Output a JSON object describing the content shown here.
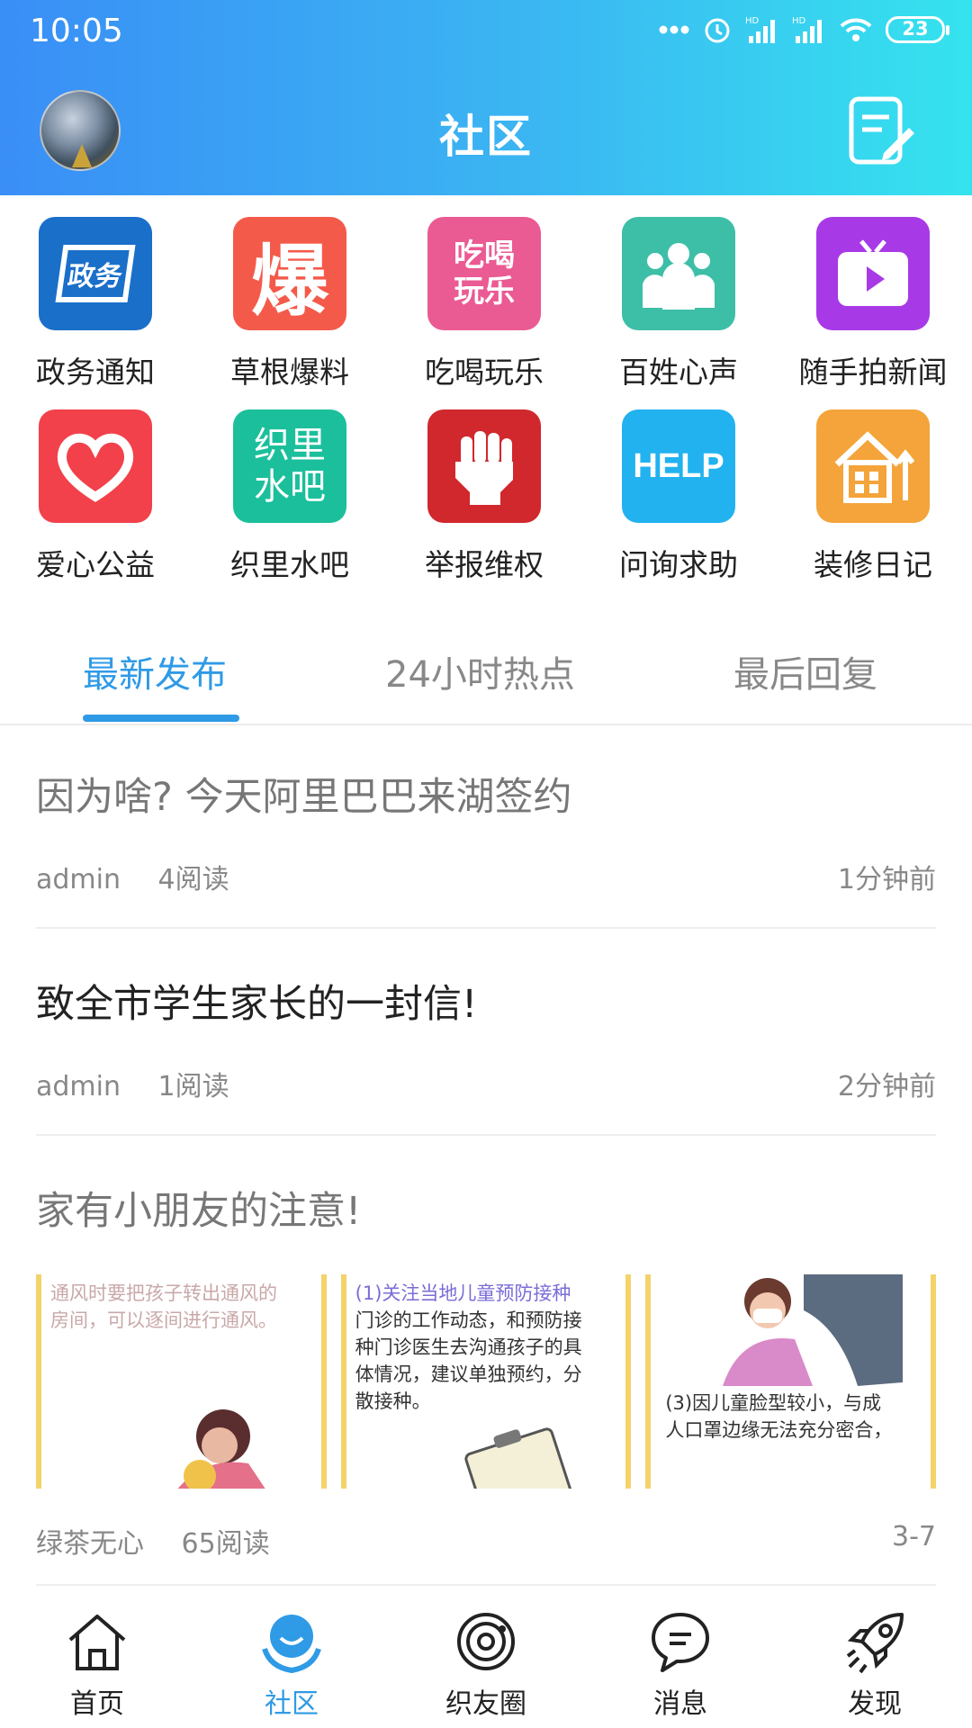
{
  "status_bar": {
    "time": "10:05",
    "battery": "23",
    "icons": [
      "dots-icon",
      "alarm-icon",
      "signal-hd-icon",
      "signal-hd-icon",
      "wifi-icon",
      "battery-icon"
    ]
  },
  "header": {
    "title": "社区",
    "avatar": "avatar",
    "compose_icon": "compose-icon"
  },
  "grid": [
    {
      "label": "政务通知",
      "tile_text": "政务",
      "color": "#1a6fc9"
    },
    {
      "label": "草根爆料",
      "tile_text": "爆",
      "color": "#f45a4a"
    },
    {
      "label": "吃喝玩乐",
      "tile_text": "吃喝玩乐",
      "color": "#ea5a93"
    },
    {
      "label": "百姓心声",
      "tile_text": "",
      "color": "#3dbfa7"
    },
    {
      "label": "随手拍新闻",
      "tile_text": "",
      "color": "#a73ae6"
    },
    {
      "label": "爱心公益",
      "tile_text": "",
      "color": "#f2414b"
    },
    {
      "label": "织里水吧",
      "tile_text": "织里水吧",
      "color": "#1bbf9b"
    },
    {
      "label": "举报维权",
      "tile_text": "",
      "color": "#d0282d"
    },
    {
      "label": "问询求助",
      "tile_text": "HELP",
      "color": "#22b2ef"
    },
    {
      "label": "装修日记",
      "tile_text": "",
      "color": "#f4a43a"
    }
  ],
  "tabs": [
    {
      "label": "最新发布",
      "active": true
    },
    {
      "label": "24小时热点",
      "active": false
    },
    {
      "label": "最后回复",
      "active": false
    }
  ],
  "posts": [
    {
      "title": "因为啥? 今天阿里巴巴来湖签约",
      "author": "admin",
      "reads": "4阅读",
      "time": "1分钟前",
      "title_color": "#777777"
    },
    {
      "title": "致全市学生家长的一封信!",
      "author": "admin",
      "reads": "1阅读",
      "time": "2分钟前",
      "title_color": "#222222"
    },
    {
      "title": "家有小朋友的注意!",
      "author": "绿茶无心",
      "reads": "65阅读",
      "time": "3-7",
      "title_color": "#777777",
      "images": [
        {
          "lines": [
            "通风时要把孩子转出通风的",
            "房间，可以逐间进行通风。"
          ]
        },
        {
          "lines": [
            "(1)关注当地儿童预防接种",
            "门诊的工作动态，和预防接",
            "种门诊医生去沟通孩子的具",
            "体情况，建议单独预约，分",
            "散接种。"
          ]
        },
        {
          "lines": [
            "(3)因儿童脸型较小，与成",
            "人口罩边缘无法充分密合，"
          ]
        }
      ]
    }
  ],
  "tabbar": [
    {
      "label": "首页",
      "icon": "home-icon",
      "active": false
    },
    {
      "label": "社区",
      "icon": "community-icon",
      "active": true
    },
    {
      "label": "织友圈",
      "icon": "planet-icon",
      "active": false
    },
    {
      "label": "消息",
      "icon": "message-icon",
      "active": false
    },
    {
      "label": "发现",
      "icon": "rocket-icon",
      "active": false
    }
  ],
  "colors": {
    "accent": "#2f9ae6",
    "header_start": "#3a8ef6",
    "header_end": "#35e3ee"
  }
}
